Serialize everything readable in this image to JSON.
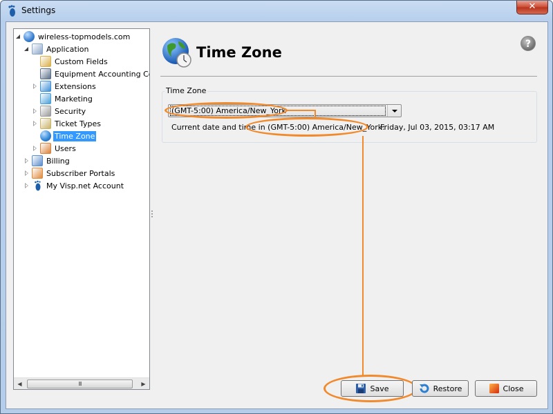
{
  "window": {
    "title": "Settings",
    "app_icon": "footprint-icon",
    "close_glyph": "✕"
  },
  "tree": {
    "items": [
      {
        "label": "wireless-topmodels.com",
        "icon": "globe-icon",
        "level": 0,
        "expander": "open"
      },
      {
        "label": "Application",
        "icon": "application-icon",
        "level": 1,
        "expander": "open"
      },
      {
        "label": "Custom Fields",
        "icon": "pencil-icon",
        "level": 2,
        "expander": "none"
      },
      {
        "label": "Equipment Accounting Control",
        "icon": "device-icon",
        "level": 2,
        "expander": "none"
      },
      {
        "label": "Extensions",
        "icon": "puzzle-icon",
        "level": 2,
        "expander": "closed"
      },
      {
        "label": "Marketing",
        "icon": "chart-icon",
        "level": 2,
        "expander": "none"
      },
      {
        "label": "Security",
        "icon": "lock-icon",
        "level": 2,
        "expander": "closed"
      },
      {
        "label": "Ticket Types",
        "icon": "ticket-icon",
        "level": 2,
        "expander": "closed"
      },
      {
        "label": "Time Zone",
        "icon": "globe-clock-icon",
        "level": 2,
        "expander": "none",
        "selected": true
      },
      {
        "label": "Users",
        "icon": "users-icon",
        "level": 2,
        "expander": "closed"
      },
      {
        "label": "Billing",
        "icon": "billing-icon",
        "level": 1,
        "expander": "closed"
      },
      {
        "label": "Subscriber Portals",
        "icon": "portal-icon",
        "level": 1,
        "expander": "closed"
      },
      {
        "label": "My Visp.net Account",
        "icon": "footprint-icon",
        "level": 1,
        "expander": "closed"
      }
    ],
    "scrollbar": {
      "left_arrow": "◀",
      "right_arrow": "▶",
      "grip": "III"
    }
  },
  "page": {
    "title": "Time Zone",
    "help_glyph": "?"
  },
  "timezone_group": {
    "title": "Time Zone",
    "selected_value": "(GMT-5:00) America/New_York",
    "current_label": "Current date and time in (GMT-5:00) America/New_York:",
    "current_value": "Friday, Jul 03, 2015, 03:17 AM"
  },
  "buttons": {
    "save": "Save",
    "restore": "Restore",
    "close": "Close"
  },
  "colors": {
    "annotation": "#f08a2c",
    "selection": "#3399ff"
  }
}
